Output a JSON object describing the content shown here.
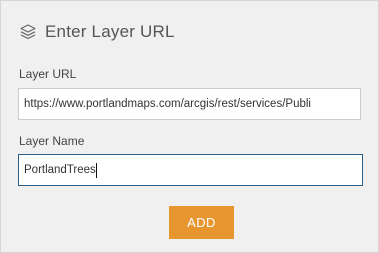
{
  "dialog": {
    "title": "Enter Layer URL",
    "icon": "layers-icon"
  },
  "fields": {
    "layer_url": {
      "label": "Layer URL",
      "value": "https://www.portlandmaps.com/arcgis/rest/services/Publi"
    },
    "layer_name": {
      "label": "Layer Name",
      "value": "PortlandTrees"
    }
  },
  "actions": {
    "add_label": "ADD"
  },
  "colors": {
    "accent": "#e7962f",
    "focus_border": "#2a5f8a",
    "panel_bg": "#f0f0f0"
  }
}
